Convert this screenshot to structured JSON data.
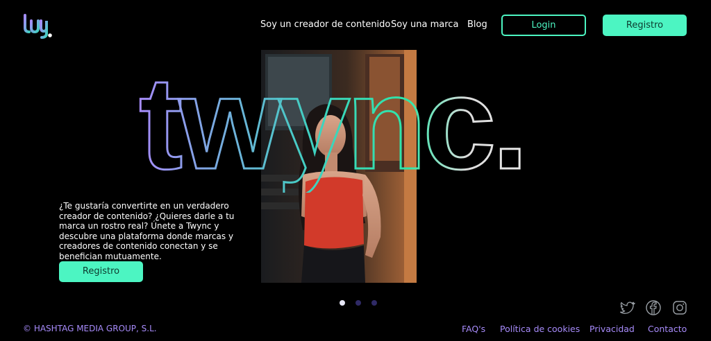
{
  "brand": {
    "logo_text": "twy.",
    "wordmark": "twync.",
    "colors": {
      "accent": "#4cf5c2",
      "purple": "#a78bfa",
      "teal": "#3fd1c0",
      "background": "#000000"
    }
  },
  "nav": {
    "items": [
      {
        "label": "Soy un creador de contenido"
      },
      {
        "label": "Soy una marca"
      },
      {
        "label": "Blog"
      }
    ],
    "login_label": "Login",
    "register_label": "Registro"
  },
  "hero": {
    "description": "¿Te gustaría convertirte en un verdadero creador de contenido? ¿Quieres darle a tu marca un rostro real? Únete a Twync y descubre una plataforma donde marcas y creadores de contenido conectan y se benefician mutuamente.",
    "cta_label": "Registro",
    "carousel": {
      "total": 3,
      "active": 1
    }
  },
  "social": {
    "icons": [
      "twitter-icon",
      "facebook-icon",
      "instagram-icon"
    ]
  },
  "footer": {
    "copyright": "© HASHTAG MEDIA GROUP, S.L.",
    "links": [
      {
        "label": "FAQ's"
      },
      {
        "label": "Política de cookies"
      },
      {
        "label": "Privacidad"
      },
      {
        "label": "Contacto"
      }
    ]
  }
}
